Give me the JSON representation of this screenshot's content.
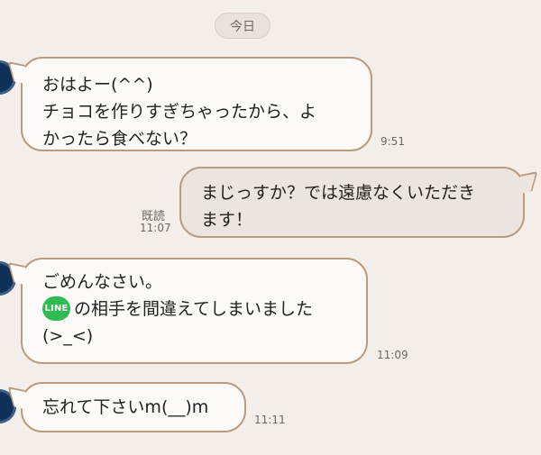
{
  "date_pill": "今日",
  "messages": [
    {
      "lines": [
        "おはよー(^^)",
        "チョコを作りすぎちゃったから、よ",
        "かったら食べない？"
      ],
      "time": "9:51"
    },
    {
      "lines": [
        "まじっすか？では遠慮なくいただき",
        "ます！"
      ],
      "read_label": "既読",
      "time": "11:07"
    },
    {
      "lines": [
        "ごめんなさい。",
        "の相手を間違えてしまいました",
        "(>_<)"
      ],
      "badge": "LINE",
      "time": "11:09"
    },
    {
      "lines": [
        "忘れて下さいm(__)m"
      ],
      "time": "11:11"
    }
  ]
}
